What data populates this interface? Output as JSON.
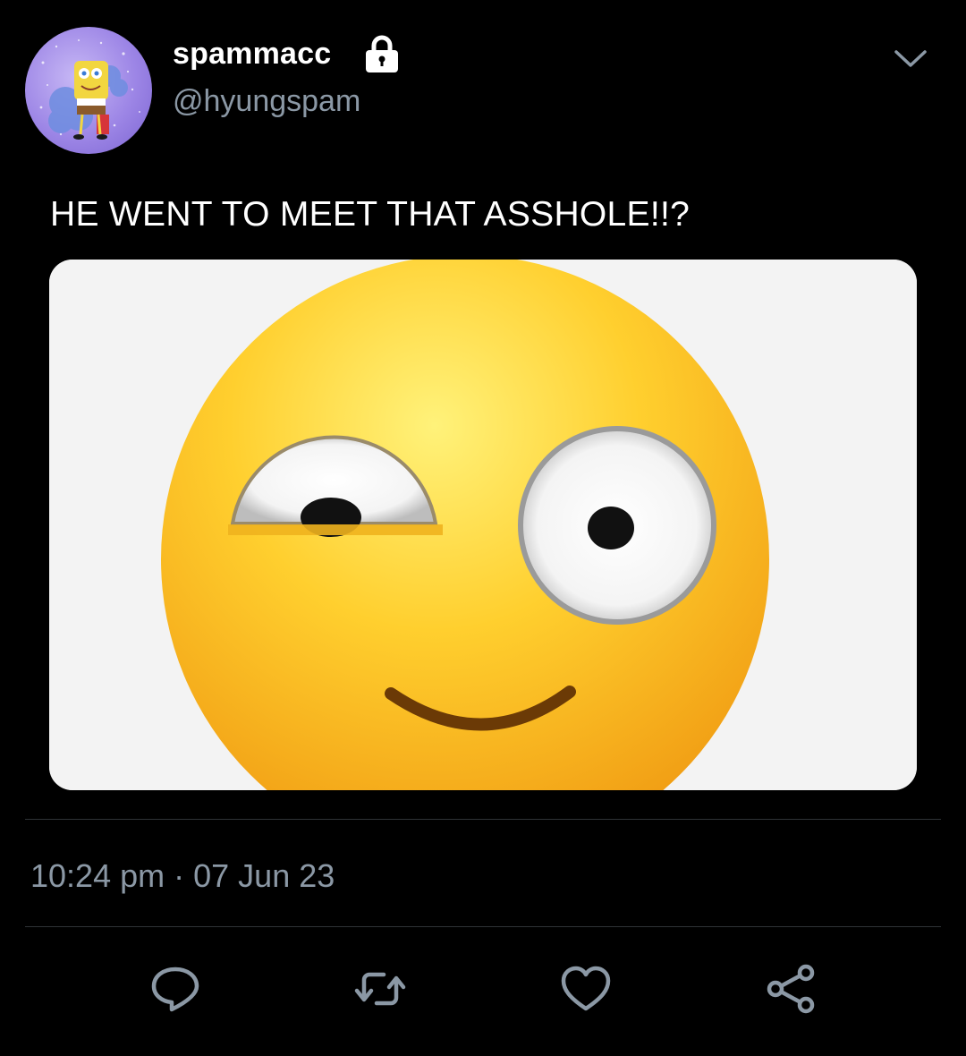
{
  "author": {
    "display_name": "spammacc",
    "handle": "@hyungspam",
    "protected_icon": "lock-icon",
    "avatar_icon": "spongebob-avatar"
  },
  "tweet": {
    "text": "HE WENT TO MEET THAT ASSHOLE!!?",
    "media_icon": "smirking-emoji-image",
    "time": "10:24 pm",
    "separator": "·",
    "date": "07 Jun 23"
  },
  "menu_icon": "chevron-down-icon",
  "actions": [
    {
      "name": "reply",
      "icon": "reply-icon"
    },
    {
      "name": "retweet",
      "icon": "retweet-icon"
    },
    {
      "name": "like",
      "icon": "heart-icon"
    },
    {
      "name": "share",
      "icon": "share-icon"
    }
  ],
  "colors": {
    "background": "#000000",
    "text": "#ffffff",
    "secondary_text": "#8b98a5",
    "divider": "#2f3336",
    "icon": "#8b98a5"
  }
}
